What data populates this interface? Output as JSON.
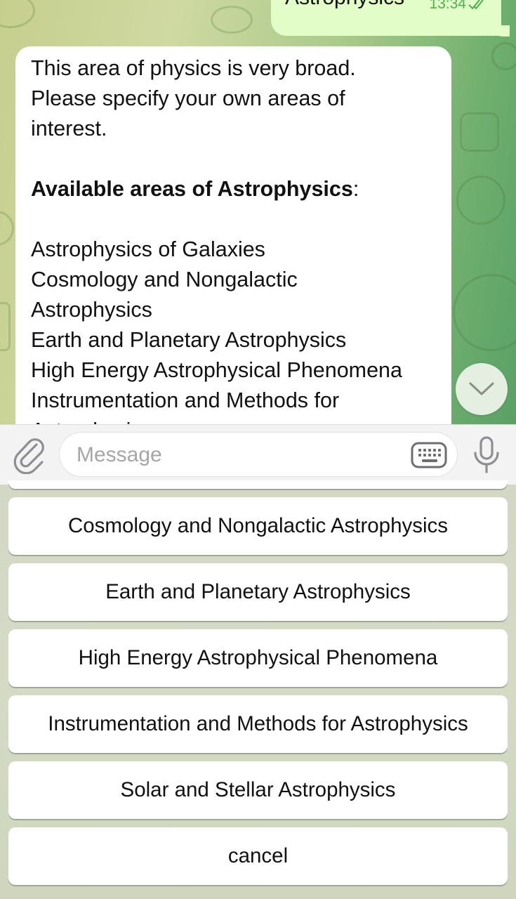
{
  "outgoing_message": {
    "text": "Astrophysics",
    "time": "13:34",
    "status": "read"
  },
  "incoming_message": {
    "lines": [
      {
        "text": "This area of physics is very broad.",
        "bold": false
      },
      {
        "text": "Please specify your own areas of",
        "bold": false
      },
      {
        "text": "interest.",
        "bold": false
      },
      {
        "text": "",
        "bold": false
      },
      {
        "text": "Available areas of Astrophysics",
        "bold": true,
        "suffix": ":"
      },
      {
        "text": "",
        "bold": false
      },
      {
        "text": "Astrophysics of Galaxies",
        "bold": false
      },
      {
        "text": "Cosmology and Nongalactic",
        "bold": false
      },
      {
        "text": "Astrophysics",
        "bold": false
      },
      {
        "text": "Earth and Planetary Astrophysics",
        "bold": false
      },
      {
        "text": "High Energy Astrophysical Phenomena",
        "bold": false
      },
      {
        "text": "Instrumentation and Methods for",
        "bold": false
      },
      {
        "text": "Astrophysics",
        "bold": false
      }
    ]
  },
  "input": {
    "placeholder": "Message"
  },
  "icons": {
    "attach": "paperclip-icon",
    "keyboard": "keyboard-icon",
    "mic": "microphone-icon",
    "scroll": "chevron-down-icon",
    "status": "double-check-icon"
  },
  "reply_keyboard": {
    "buttons": [
      "Cosmology and Nongalactic Astrophysics",
      "Earth and Planetary Astrophysics",
      "High Energy Astrophysical Phenomena",
      "Instrumentation and Methods for Astrophysics",
      "Solar and Stellar Astrophysics",
      "cancel"
    ]
  },
  "colors": {
    "outgoing_bubble": "#e2fdc8",
    "time_green": "#4caf50",
    "placeholder": "#a6a6a6"
  }
}
